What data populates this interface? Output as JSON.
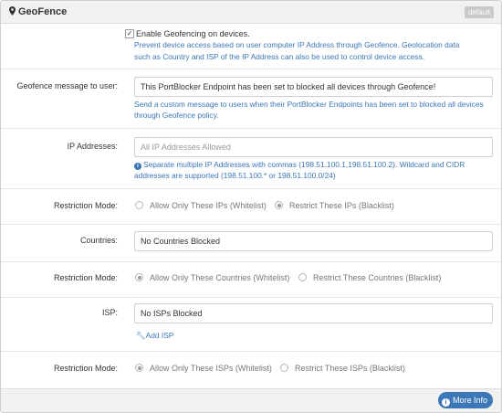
{
  "panel": {
    "title": "GeoFence",
    "badge": "default",
    "pin_icon": "map-marker-icon"
  },
  "enable": {
    "checked": true,
    "label": "Enable Geofencing on devices.",
    "help_line1": "Prevent device access based on user computer IP Address through Geofence. Geolocation data",
    "help_line2": "such as Country and ISP of the IP Address can also be used to control device access."
  },
  "message": {
    "label": "Geofence message to user:",
    "value": "This PortBlocker Endpoint has been set to blocked all devices through Geofence!",
    "help_line1": "Send a custom message to users when their PortBlocker Endpoints has been set to blocked all devices",
    "help_line2": "through Geofence policy."
  },
  "ip": {
    "label": "IP Addresses:",
    "placeholder": "All IP Addresses Allowed",
    "help_line1": "Separate multiple IP Addresses with commas (198.51.100.1,198.51.100.2). Wildcard and CIDR",
    "help_line2": "addresses are supported (198.51.100.* or 198.51.100.0/24)"
  },
  "ip_mode": {
    "label": "Restriction Mode:",
    "whitelist": "Allow Only These IPs (Whitelist)",
    "blacklist": "Restrict These IPs (Blacklist)",
    "selected": "blacklist"
  },
  "countries": {
    "label": "Countries:",
    "value": "No Countries Blocked"
  },
  "country_mode": {
    "label": "Restriction Mode:",
    "whitelist": "Allow Only These Countries (Whitelist)",
    "blacklist": "Restrict These Countries (Blacklist)",
    "selected": "whitelist"
  },
  "isp": {
    "label": "ISP:",
    "value": "No ISPs Blocked",
    "add_label": "Add ISP"
  },
  "isp_mode": {
    "label": "Restriction Mode:",
    "whitelist": "Allow Only These ISPs (Whitelist)",
    "blacklist": "Restrict These ISPs (Blacklist)",
    "selected": "whitelist"
  },
  "footer": {
    "more_info": "More Info"
  },
  "colors": {
    "accent": "#3c77b8",
    "header_bg": "#f1f1f1",
    "badge_bg": "#c9c9c9"
  }
}
